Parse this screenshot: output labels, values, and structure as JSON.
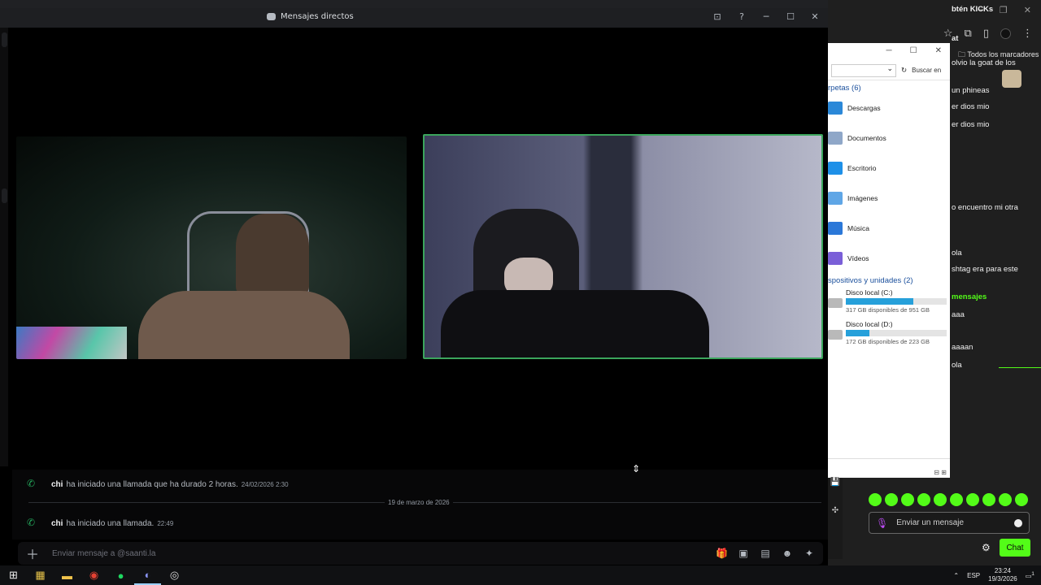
{
  "background": {
    "bookmarks_label": "Todos los marcadores",
    "explorer": {
      "search_placeholder": "Buscar en",
      "folders_header": "rpetas (6)",
      "folders": [
        {
          "label": "Descargas",
          "color": "#2b88d8"
        },
        {
          "label": "Documentos",
          "color": "#8fa7c8"
        },
        {
          "label": "Escritorio",
          "color": "#1e90e8"
        },
        {
          "label": "Imágenes",
          "color": "#5fa6e6"
        },
        {
          "label": "Música",
          "color": "#2b78d8"
        },
        {
          "label": "Vídeos",
          "color": "#7a5fd8"
        }
      ],
      "drives_header": "spositivos y unidades (2)",
      "drives": [
        {
          "label": "Disco local (C:)",
          "free": "317 GB disponibles de 951 GB",
          "used_fraction": 0.67
        },
        {
          "label": "Disco local (D:)",
          "free": "172 GB disponibles de 223 GB",
          "used_fraction": 0.23
        }
      ]
    },
    "kick_chat": {
      "lines": [
        "btén KICKs",
        "at",
        "olvio la goat de los",
        "un phineas",
        "er dios mio",
        "er dios mio",
        "o encuentro mi otra",
        "ola",
        "shtag era para este",
        "mensajes",
        "aaa",
        "aaaan",
        "ola"
      ],
      "input_placeholder": "Enviar un mensaje",
      "chat_button": "Chat",
      "accent": "#53fc18"
    }
  },
  "discord": {
    "title": "Mensajes directos",
    "accent_speaking": "#3ba55c",
    "call_log": [
      {
        "user": "chi",
        "text": "ha iniciado una llamada que ha durado 2 horas.",
        "time": "24/02/2026 2:30"
      },
      {
        "user": "chi",
        "text": "ha iniciado una llamada.",
        "time": "22:49"
      }
    ],
    "date_divider": "19 de marzo de 2026",
    "composer_placeholder": "Enviar mensaje a @saanti.la",
    "composer_tools": [
      "gift-icon",
      "gif-icon",
      "sticker-icon",
      "emoji-icon",
      "apps-icon"
    ]
  },
  "taskbar": {
    "apps": [
      "windows-start-icon",
      "store-icon",
      "file-explorer-icon",
      "chrome-icon",
      "spotify-icon",
      "discord-icon",
      "obs-icon"
    ],
    "language": "ESP",
    "time": "23:24",
    "date": "19/3/2026",
    "notifications": "1"
  }
}
